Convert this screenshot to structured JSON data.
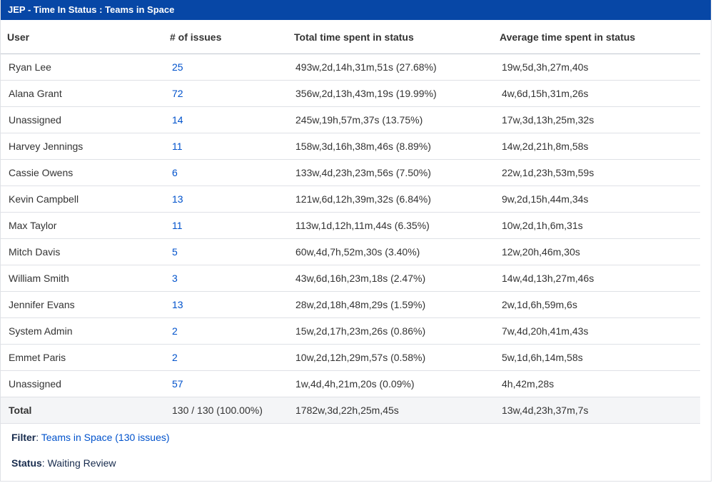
{
  "gadget": {
    "title": "JEP - Time In Status : Teams in Space"
  },
  "table": {
    "headers": [
      "User",
      "# of issues",
      "Total time spent in status",
      "Average time spent in status"
    ],
    "rows": [
      {
        "user": "Ryan Lee",
        "issues": "25",
        "total": "493w,2d,14h,31m,51s (27.68%)",
        "avg": "19w,5d,3h,27m,40s"
      },
      {
        "user": "Alana Grant",
        "issues": "72",
        "total": "356w,2d,13h,43m,19s (19.99%)",
        "avg": "4w,6d,15h,31m,26s"
      },
      {
        "user": "Unassigned",
        "issues": "14",
        "total": "245w,19h,57m,37s (13.75%)",
        "avg": "17w,3d,13h,25m,32s"
      },
      {
        "user": "Harvey Jennings",
        "issues": "11",
        "total": "158w,3d,16h,38m,46s (8.89%)",
        "avg": "14w,2d,21h,8m,58s"
      },
      {
        "user": "Cassie Owens",
        "issues": "6",
        "total": "133w,4d,23h,23m,56s (7.50%)",
        "avg": "22w,1d,23h,53m,59s"
      },
      {
        "user": "Kevin Campbell",
        "issues": "13",
        "total": "121w,6d,12h,39m,32s (6.84%)",
        "avg": "9w,2d,15h,44m,34s"
      },
      {
        "user": "Max Taylor",
        "issues": "11",
        "total": "113w,1d,12h,11m,44s (6.35%)",
        "avg": "10w,2d,1h,6m,31s"
      },
      {
        "user": "Mitch Davis",
        "issues": "5",
        "total": "60w,4d,7h,52m,30s (3.40%)",
        "avg": "12w,20h,46m,30s"
      },
      {
        "user": "William Smith",
        "issues": "3",
        "total": "43w,6d,16h,23m,18s (2.47%)",
        "avg": "14w,4d,13h,27m,46s"
      },
      {
        "user": "Jennifer Evans",
        "issues": "13",
        "total": "28w,2d,18h,48m,29s (1.59%)",
        "avg": "2w,1d,6h,59m,6s"
      },
      {
        "user": "System Admin",
        "issues": "2",
        "total": "15w,2d,17h,23m,26s (0.86%)",
        "avg": "7w,4d,20h,41m,43s"
      },
      {
        "user": "Emmet Paris",
        "issues": "2",
        "total": "10w,2d,12h,29m,57s (0.58%)",
        "avg": "5w,1d,6h,14m,58s"
      },
      {
        "user": "Unassigned",
        "issues": "57",
        "total": "1w,4d,4h,21m,20s (0.09%)",
        "avg": "4h,42m,28s"
      }
    ],
    "total": {
      "label": "Total",
      "issues": "130 / 130 (100.00%)",
      "total": "1782w,3d,22h,25m,45s",
      "avg": "13w,4d,23h,37m,7s"
    }
  },
  "footer": {
    "filter_label": "Filter",
    "filter_value": "Teams in Space (130 issues)",
    "status_label": "Status",
    "status_value": "Waiting Review"
  }
}
